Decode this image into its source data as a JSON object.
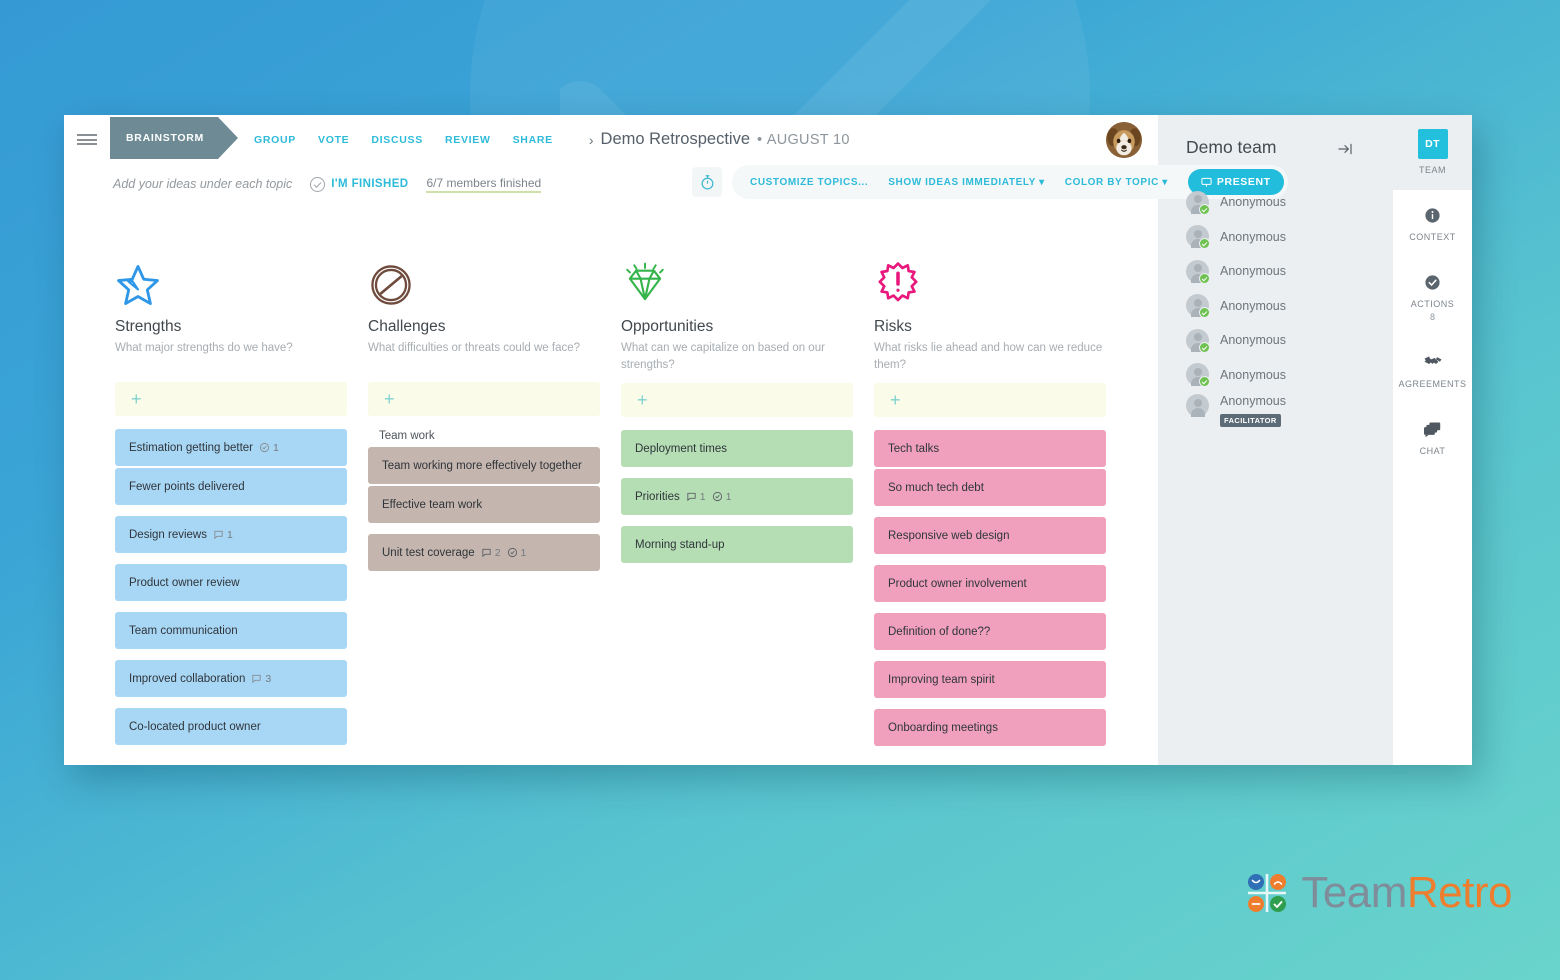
{
  "window": {
    "title": "Demo Retrospective",
    "date": "AUGUST 10",
    "chevron": "›"
  },
  "nav": {
    "menu_icon": "hamburger-menu-icon",
    "active_stage": "BRAINSTORM",
    "stages": [
      "GROUP",
      "VOTE",
      "DISCUSS",
      "REVIEW",
      "SHARE"
    ],
    "avatar_alt": "dog-avatar"
  },
  "subbar": {
    "hint": "Add your ideas under each topic",
    "finished_label": "I'M FINISHED",
    "members_finished": "6/7 members finished",
    "timer_icon": "timer-icon",
    "tools": [
      "CUSTOMIZE TOPICS...",
      "SHOW IDEAS IMMEDIATELY ▾",
      "COLOR BY TOPIC ▾"
    ],
    "present_label": "PRESENT",
    "present_icon": "present-screen-icon"
  },
  "columns": [
    {
      "id": "strengths",
      "icon": "star-icon",
      "title": "Strengths",
      "subtitle": "What major strengths do we have?",
      "add_label": "+",
      "color_class": "c-blue",
      "groups": [
        {
          "label": "",
          "cards": [
            {
              "text": "Estimation getting better",
              "votes": "1",
              "comments": ""
            },
            {
              "text": "Fewer points delivered",
              "votes": "",
              "comments": ""
            }
          ]
        },
        {
          "label": "",
          "cards": [
            {
              "text": "Design reviews",
              "votes": "",
              "comments": "1"
            }
          ]
        },
        {
          "label": "",
          "cards": [
            {
              "text": "Product owner review",
              "votes": "",
              "comments": ""
            }
          ]
        },
        {
          "label": "",
          "cards": [
            {
              "text": "Team communication",
              "votes": "",
              "comments": ""
            }
          ]
        },
        {
          "label": "",
          "cards": [
            {
              "text": "Improved collaboration",
              "votes": "",
              "comments": "3"
            }
          ]
        },
        {
          "label": "",
          "cards": [
            {
              "text": "Co-located product owner",
              "votes": "",
              "comments": ""
            }
          ]
        }
      ]
    },
    {
      "id": "challenges",
      "icon": "no-entry-icon",
      "title": "Challenges",
      "subtitle": "What difficulties or threats could we face?",
      "add_label": "+",
      "color_class": "c-brown",
      "groups": [
        {
          "label": "Team work",
          "cards": [
            {
              "text": "Team working more effectively together",
              "votes": "",
              "comments": ""
            },
            {
              "text": "Effective team work",
              "votes": "",
              "comments": ""
            }
          ]
        },
        {
          "label": "",
          "cards": [
            {
              "text": "Unit test coverage",
              "votes": "1",
              "comments": "2"
            }
          ]
        }
      ]
    },
    {
      "id": "opportunities",
      "icon": "diamond-icon",
      "title": "Opportunities",
      "subtitle": "What can we capitalize on based on our strengths?",
      "add_label": "+",
      "color_class": "c-green",
      "groups": [
        {
          "label": "",
          "cards": [
            {
              "text": "Deployment times",
              "votes": "",
              "comments": ""
            }
          ]
        },
        {
          "label": "",
          "cards": [
            {
              "text": "Priorities",
              "votes": "1",
              "comments": "1"
            }
          ]
        },
        {
          "label": "",
          "cards": [
            {
              "text": "Morning stand-up",
              "votes": "",
              "comments": ""
            }
          ]
        }
      ]
    },
    {
      "id": "risks",
      "icon": "warning-burst-icon",
      "title": "Risks",
      "subtitle": "What risks lie ahead and how can we reduce them?",
      "add_label": "+",
      "color_class": "c-pink",
      "groups": [
        {
          "label": "",
          "cards": [
            {
              "text": "Tech talks",
              "votes": "",
              "comments": ""
            },
            {
              "text": "So much tech debt",
              "votes": "",
              "comments": ""
            }
          ]
        },
        {
          "label": "",
          "cards": [
            {
              "text": "Responsive web design",
              "votes": "",
              "comments": ""
            }
          ]
        },
        {
          "label": "",
          "cards": [
            {
              "text": "Product owner involvement",
              "votes": "",
              "comments": ""
            }
          ]
        },
        {
          "label": "",
          "cards": [
            {
              "text": "Definition of done??",
              "votes": "",
              "comments": ""
            }
          ]
        },
        {
          "label": "",
          "cards": [
            {
              "text": "Improving team spirit",
              "votes": "",
              "comments": ""
            }
          ]
        },
        {
          "label": "",
          "cards": [
            {
              "text": "Onboarding meetings",
              "votes": "",
              "comments": ""
            }
          ]
        }
      ]
    }
  ],
  "right_panel": {
    "team_name": "Demo team",
    "collapse_icon": "collapse-panel-icon",
    "members": [
      {
        "name": "Anonymous",
        "online": true,
        "badge": ""
      },
      {
        "name": "Anonymous",
        "online": true,
        "badge": ""
      },
      {
        "name": "Anonymous",
        "online": true,
        "badge": ""
      },
      {
        "name": "Anonymous",
        "online": true,
        "badge": ""
      },
      {
        "name": "Anonymous",
        "online": true,
        "badge": ""
      },
      {
        "name": "Anonymous",
        "online": true,
        "badge": ""
      },
      {
        "name": "Anonymous",
        "online": false,
        "badge": "FACILITATOR"
      }
    ],
    "rail": [
      {
        "id": "team",
        "initials": "DT",
        "label": "TEAM",
        "count": "",
        "icon": "team-initials-icon",
        "active": true
      },
      {
        "id": "context",
        "initials": "",
        "label": "CONTEXT",
        "count": "",
        "icon": "info-icon",
        "active": false
      },
      {
        "id": "actions",
        "initials": "",
        "label": "ACTIONS",
        "count": "8",
        "icon": "check-circle-icon",
        "active": false
      },
      {
        "id": "agreements",
        "initials": "",
        "label": "AGREEMENTS",
        "count": "",
        "icon": "handshake-icon",
        "active": false
      },
      {
        "id": "chat",
        "initials": "",
        "label": "CHAT",
        "count": "",
        "icon": "chat-bubbles-icon",
        "active": false
      }
    ]
  },
  "logo": {
    "word_first": "Team",
    "word_second": "Retro",
    "mark": "four-faces-grid-icon"
  },
  "colors": {
    "brand_cyan": "#22bcdd",
    "stage_active": "#6d8a95",
    "strengths": "#a8d6f5",
    "challenges": "#c4b5ae",
    "opportunities": "#b5deb4",
    "risks": "#f0a0bd",
    "add_card": "#fbfbe9",
    "logo_orange": "#ef7d2e",
    "logo_grey": "#7f8c99"
  }
}
